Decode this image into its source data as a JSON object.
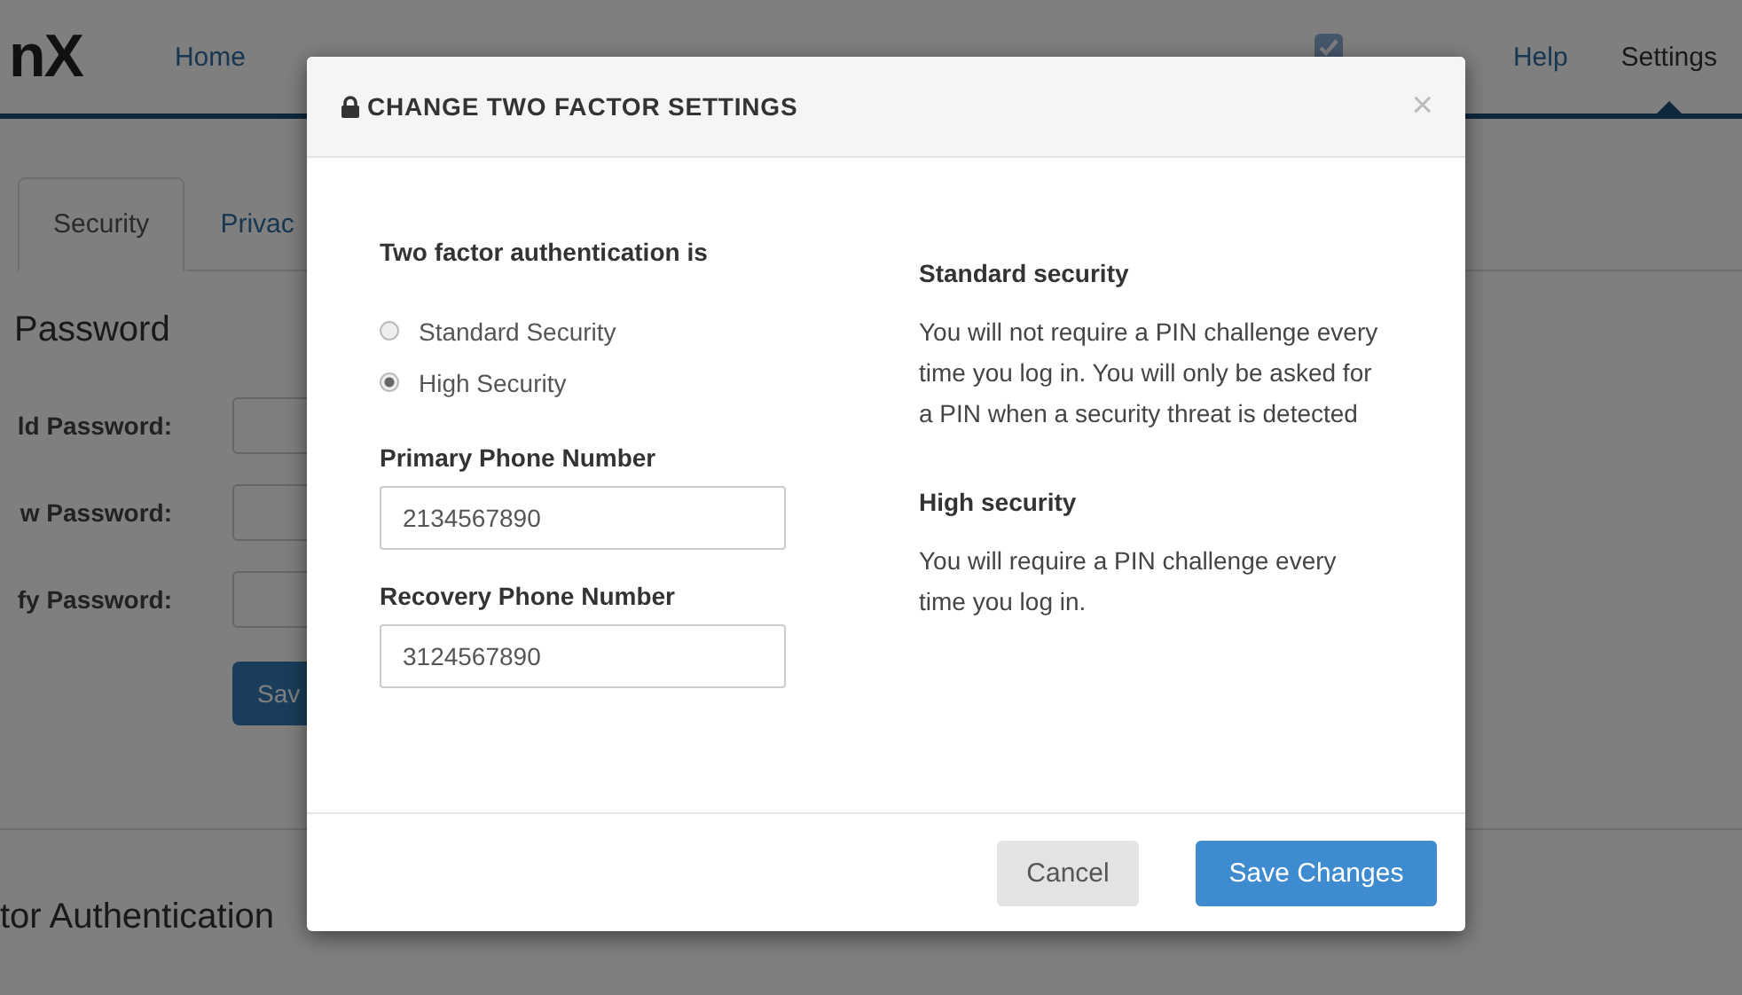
{
  "nav": {
    "logo": "nX",
    "items": [
      {
        "kind": "link",
        "label": "Home",
        "selected": false
      },
      {
        "kind": "icon",
        "selected": false
      },
      {
        "kind": "link",
        "label": "Help",
        "selected": false
      },
      {
        "kind": "link",
        "label": "Settings",
        "selected": true
      }
    ]
  },
  "tabs": [
    {
      "label": "Security",
      "selected": true
    },
    {
      "label": "Privac",
      "selected": false
    }
  ],
  "password_section": {
    "heading": "Password",
    "fields": [
      {
        "label": "ld Password:"
      },
      {
        "label": "w Password:"
      },
      {
        "label": "fy Password:"
      }
    ],
    "button": "Sav"
  },
  "two_factor_heading": "tor Authentication",
  "modal": {
    "title": "CHANGE TWO FACTOR SETTINGS",
    "close": "×",
    "auth_label": "Two factor authentication is",
    "options": [
      {
        "label": "Standard Security",
        "selected": false
      },
      {
        "label": "High Security",
        "selected": true
      }
    ],
    "phones": [
      {
        "label": "Primary Phone Number",
        "value": "2134567890"
      },
      {
        "label": "Recovery Phone Number",
        "value": "3124567890"
      }
    ],
    "info": [
      {
        "heading": "Standard security",
        "text": "You will not require a PIN challenge every time you log in. You will only be asked for a PIN when a security threat is detected"
      },
      {
        "heading": "High security",
        "text": "You will require a PIN challenge every time you log in."
      }
    ],
    "buttons": [
      {
        "label": "Cancel",
        "kind": "secondary"
      },
      {
        "label": "Save Changes",
        "kind": "primary"
      }
    ]
  }
}
